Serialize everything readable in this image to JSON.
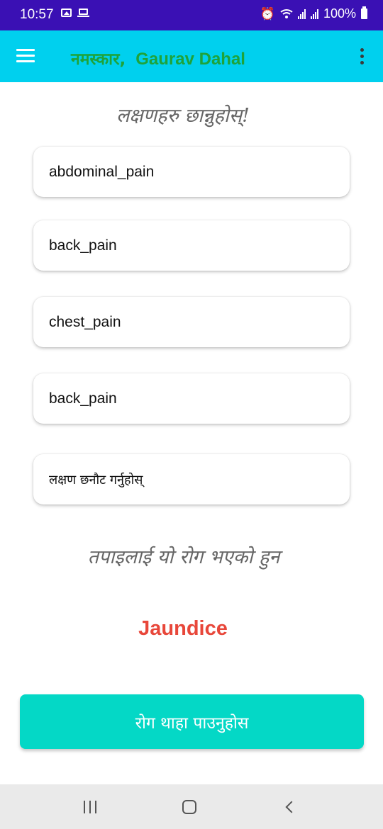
{
  "status_bar": {
    "time": "10:57",
    "battery": "100%",
    "icons": [
      "gallery-icon",
      "laptop-icon",
      "alarm-icon",
      "wifi-icon",
      "signal-icon",
      "signal-icon",
      "battery-icon"
    ]
  },
  "app_bar": {
    "greeting": "नमस्कार,",
    "user_name": "Gaurav Dahal",
    "colors": {
      "background": "#00d0ee",
      "greeting": "#1ea33a"
    }
  },
  "main": {
    "heading": "लक्षणहरु छान्नुहोस्!",
    "symptoms": [
      "abdominal_pain",
      "back_pain",
      "chest_pain",
      "back_pain"
    ],
    "symptom_placeholder": "लक्षण छनौट गर्नुहोस्",
    "result_label": "तपाइलाई यो रोग भएको हुन",
    "result": "Jaundice",
    "predict_button": "रोग थाहा पाउनुहोस",
    "colors": {
      "result": "#e8473a",
      "button": "#04d8c6"
    }
  }
}
